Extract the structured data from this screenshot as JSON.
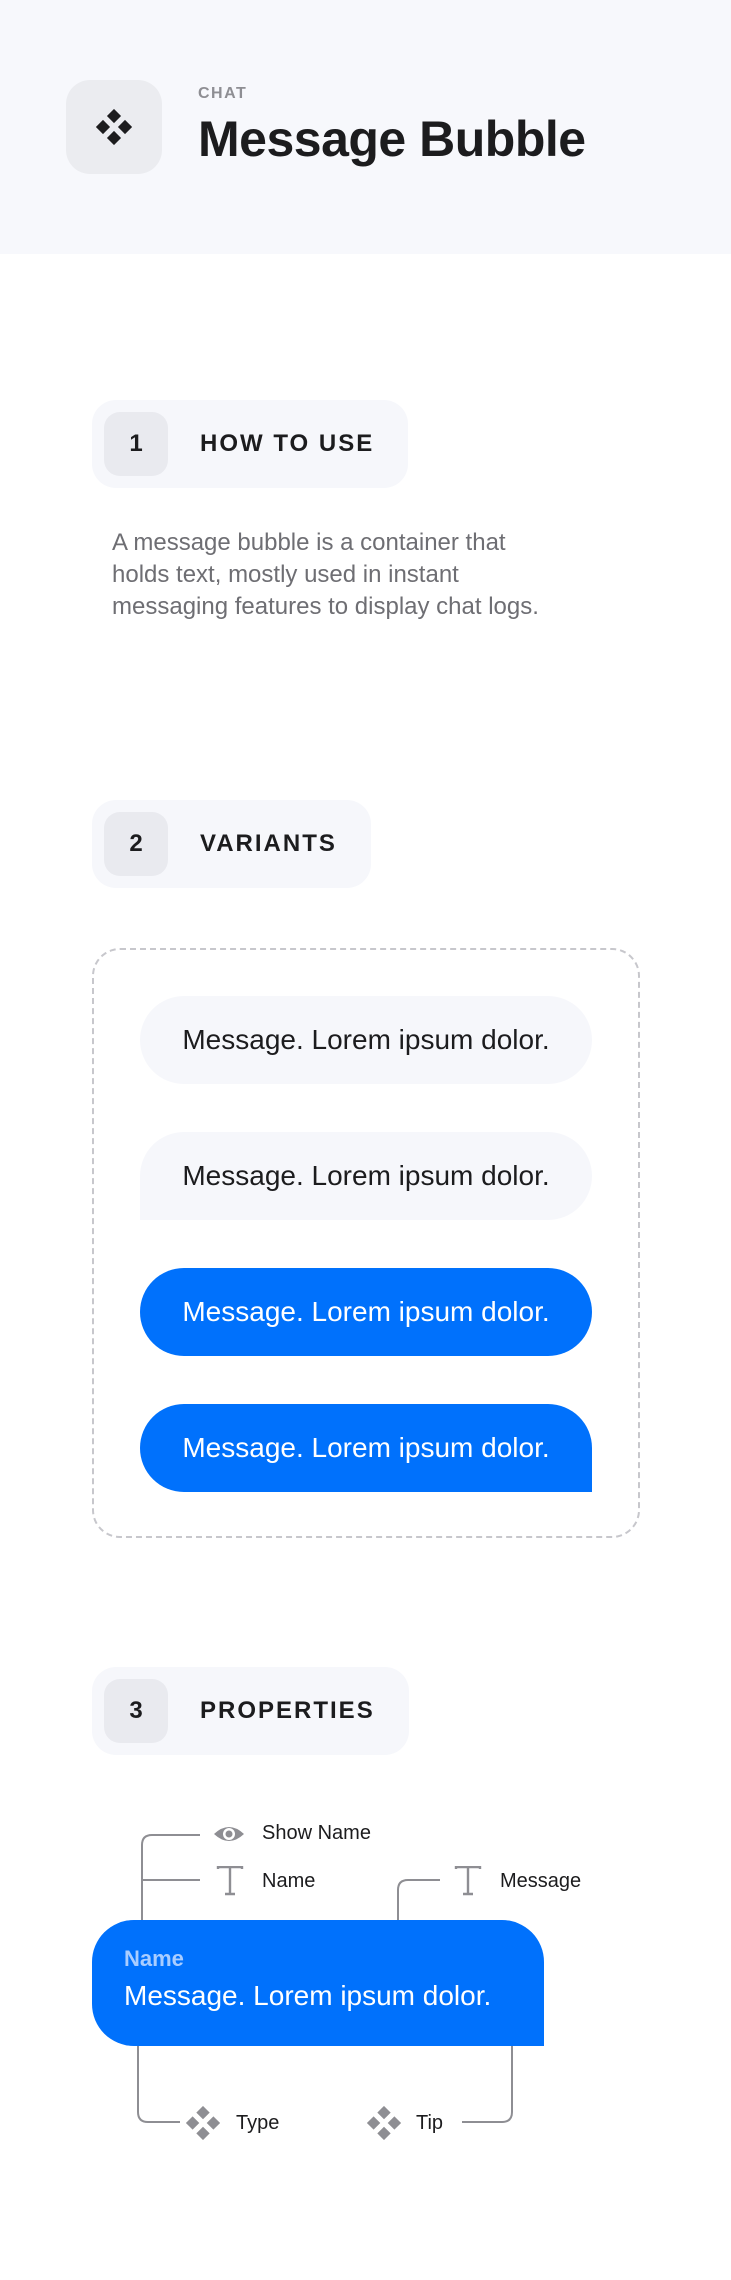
{
  "header": {
    "category": "CHAT",
    "title": "Message Bubble",
    "icon": "component-icon"
  },
  "sections": [
    {
      "number": "1",
      "title": "HOW TO USE"
    },
    {
      "number": "2",
      "title": "VARIANTS"
    },
    {
      "number": "3",
      "title": "PROPERTIES"
    }
  ],
  "how_to_use": {
    "description": "A message bubble is a container that holds text, mostly used in instant messaging features to display chat logs."
  },
  "variants": [
    {
      "text": "Message. Lorem ipsum dolor.",
      "style": "light",
      "tip": "none"
    },
    {
      "text": "Message. Lorem ipsum dolor.",
      "style": "light",
      "tip": "bottom-left"
    },
    {
      "text": "Message. Lorem ipsum dolor.",
      "style": "blue",
      "tip": "none"
    },
    {
      "text": "Message. Lorem ipsum dolor.",
      "style": "blue",
      "tip": "bottom-right"
    }
  ],
  "properties": {
    "bubble_name": "Name",
    "bubble_message": "Message. Lorem ipsum dolor.",
    "show_name_label": "Show Name",
    "name_label": "Name",
    "message_label": "Message",
    "type_label": "Type",
    "tip_label": "Tip"
  },
  "colors": {
    "accent": "#0071fc",
    "light_bubble": "#f6f7fb",
    "header_bg": "#f7f8fc"
  }
}
